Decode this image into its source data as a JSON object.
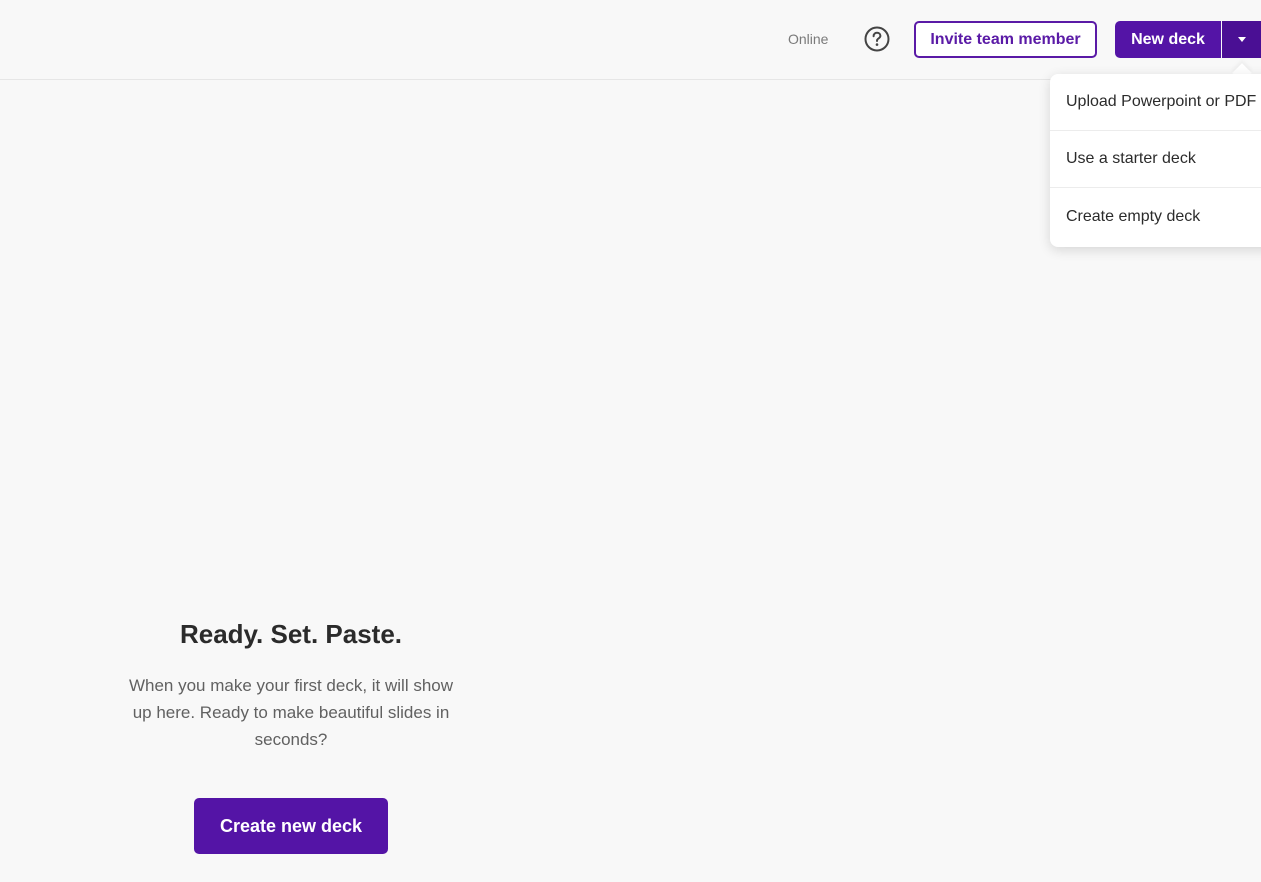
{
  "header": {
    "status": "Online",
    "help_icon": "question-circle-icon",
    "invite_label": "Invite team member",
    "new_deck_label": "New deck",
    "caret_icon": "caret-down-icon"
  },
  "dropdown": {
    "items": [
      {
        "label": "Upload Powerpoint or PDF"
      },
      {
        "label": "Use a starter deck"
      },
      {
        "label": "Create empty deck"
      }
    ]
  },
  "empty_state": {
    "title": "Ready. Set. Paste.",
    "description": "When you make your first deck, it will show up here. Ready to make beautiful slides in seconds?",
    "button_label": "Create new deck"
  },
  "colors": {
    "accent": "#5414a6",
    "accent_dark": "#4a0f94",
    "background": "#f8f8f8"
  }
}
